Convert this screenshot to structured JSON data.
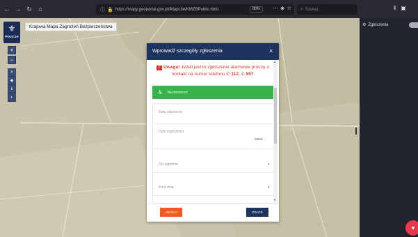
{
  "browser": {
    "url": "https://mapy.geoportal.gov.pl/iMapLite/KMZBPublic.html",
    "zoom": "80%",
    "search_placeholder": "Szukaj",
    "icons": [
      "back-icon",
      "forward-icon",
      "reload-icon",
      "home-icon",
      "info-icon",
      "lock-icon",
      "more-icon",
      "pocket-icon",
      "bookmark-star-icon",
      "search-icon",
      "library-icon",
      "sidebar-icon"
    ]
  },
  "map": {
    "title": "Krajowa Mapa Zagrożeń Bezpieczeństwa",
    "logo_text": "POLICJA",
    "zoom_in": "+",
    "zoom_out": "−",
    "colors": {
      "background": "#c8c3aa",
      "toolbar": "#3a4a70"
    }
  },
  "panel": {
    "title": "Zgłoszenia",
    "badge": "",
    "fab_icon": "filter-icon",
    "background": "#20242c",
    "fab_color": "#e43a4b"
  },
  "modal": {
    "title": "Wprowadź szczegóły zgłoszenia",
    "warning": {
      "bold": "Uwaga!",
      "text": "Jeżeli jest to zgłoszenie alarmowe proszę o kontakt na numer telefonu",
      "num1": "112",
      "num2": "997"
    },
    "category": "Bezdomność",
    "fields": {
      "date_label": "Data zdarzenia",
      "desc_label": "Opis zagrożenia",
      "desc_counter": "0/500",
      "day_label": "Dni tygodnia",
      "time_label": "Pora dnia"
    },
    "buttons": {
      "cancel": "ANULUJ",
      "submit": "ZGŁOŚ"
    },
    "colors": {
      "header": "#1d3461",
      "category": "#37b34a",
      "warning": "#d43a2f",
      "cancel": "#f05a24"
    }
  }
}
